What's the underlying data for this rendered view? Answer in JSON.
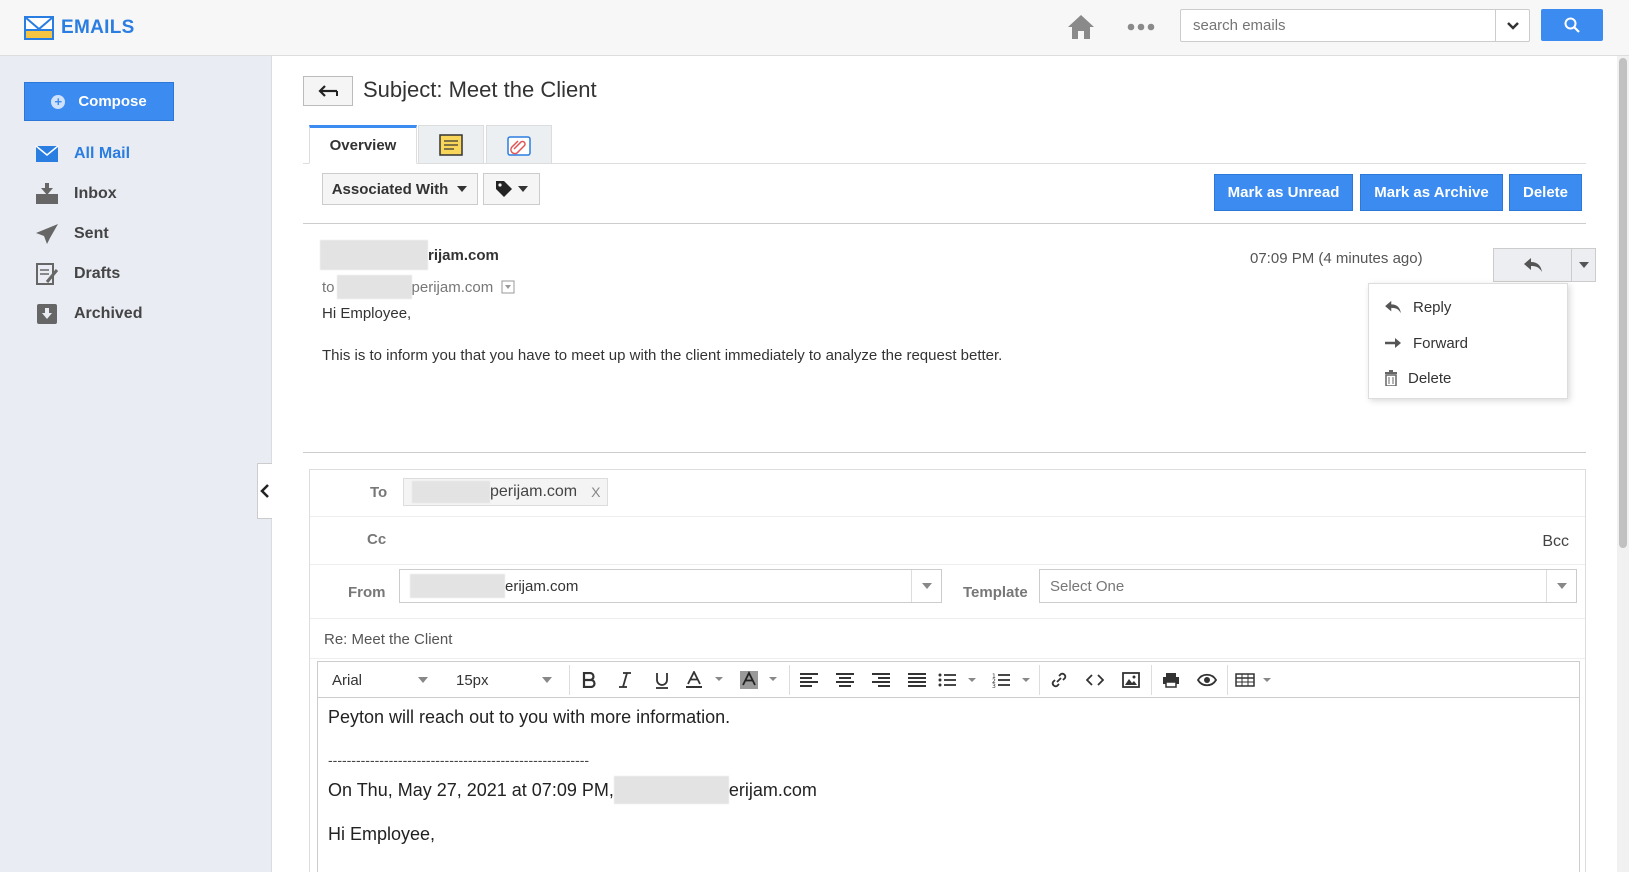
{
  "header": {
    "app_title": "EMAILS",
    "search_placeholder": "search emails"
  },
  "sidebar": {
    "compose_label": "Compose",
    "items": [
      {
        "label": "All Mail",
        "icon": "envelope-icon",
        "active": true
      },
      {
        "label": "Inbox",
        "icon": "inbox-tray-icon",
        "active": false
      },
      {
        "label": "Sent",
        "icon": "paper-plane-icon",
        "active": false
      },
      {
        "label": "Drafts",
        "icon": "drafts-icon",
        "active": false
      },
      {
        "label": "Archived",
        "icon": "archive-box-icon",
        "active": false
      }
    ]
  },
  "email": {
    "subject": "Subject: Meet the Client",
    "tabs": [
      {
        "label": "Overview",
        "active": true
      },
      {
        "icon": "notes-icon"
      },
      {
        "icon": "attachments-icon"
      }
    ],
    "associated_with_label": "Associated With",
    "actions": {
      "mark_unread": "Mark as Unread",
      "mark_archive": "Mark as Archive",
      "delete": "Delete"
    },
    "sender_suffix": "rijam.com",
    "to_prefix": "to",
    "to_suffix": "perijam.com",
    "timestamp": "07:09 PM (4 minutes ago)",
    "reply_menu": {
      "reply": "Reply",
      "forward": "Forward",
      "delete": "Delete"
    },
    "greeting": "Hi Employee,",
    "body": "This is to inform you that you have to meet up with the client immediately to analyze the request better."
  },
  "reply_form": {
    "to_label": "To",
    "to_recipient_suffix": "perijam.com",
    "remove_label": "X",
    "cc_label": "Cc",
    "bcc_label": "Bcc",
    "from_label": "From",
    "from_suffix": "erijam.com",
    "template_label": "Template",
    "template_value": "Select One",
    "subject_value": "Re: Meet the Client",
    "toolbar": {
      "font_family": "Arial",
      "font_size": "15px"
    },
    "editor_lines": {
      "line1": "Peyton will reach out to you with more information.",
      "separator": "--------------------------------------------------------",
      "quote_prefix": "On Thu, May 27, 2021 at 07:09 PM,",
      "quote_suffix": "erijam.com",
      "greeting": "Hi Employee,"
    }
  },
  "colors": {
    "accent": "#3b8bf0",
    "brand_text": "#2a7de1",
    "sidebar_bg": "#e9edf3"
  }
}
